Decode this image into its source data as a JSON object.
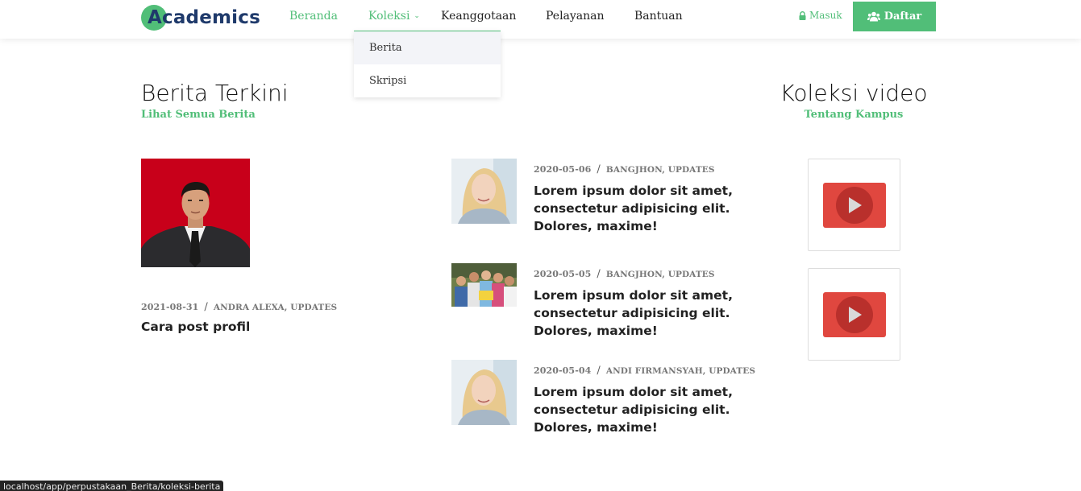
{
  "brand": {
    "name": "Academics",
    "accent": "#51be78",
    "logo_text_color": "#1f3a6b"
  },
  "nav": {
    "items": [
      {
        "label": "Beranda"
      },
      {
        "label": "Koleksi"
      },
      {
        "label": "Keanggotaan"
      },
      {
        "label": "Pelayanan"
      },
      {
        "label": "Bantuan"
      }
    ],
    "login_label": "Masuk",
    "register_label": "Daftar"
  },
  "koleksi_dropdown": {
    "items": [
      {
        "label": "Berita"
      },
      {
        "label": "Skripsi"
      }
    ]
  },
  "news_section": {
    "title": "Berita Terkini",
    "link_label": "Lihat Semua Berita"
  },
  "featured": {
    "date": "2021-08-31",
    "tags": "ANDRA ALEXA, UPDATES",
    "title": "Cara post profil"
  },
  "news_list": [
    {
      "date": "2020-05-06",
      "tags": "BANGJHON, UPDATES",
      "title": "Lorem ipsum dolor sit amet, consectetur adipisicing elit. Dolores, maxime!"
    },
    {
      "date": "2020-05-05",
      "tags": "BANGJHON, UPDATES",
      "title": "Lorem ipsum dolor sit amet, consectetur adipisicing elit. Dolores, maxime!"
    },
    {
      "date": "2020-05-04",
      "tags": "ANDI FIRMANSYAH, UPDATES",
      "title": "Lorem ipsum dolor sit amet, consectetur adipisicing elit. Dolores, maxime!"
    }
  ],
  "video_section": {
    "title": "Koleksi video",
    "link_label": "Tentang Kampus"
  },
  "status_bar": {
    "url": "localhost/app/perpustakaan_Berita/koleksi-berita"
  }
}
